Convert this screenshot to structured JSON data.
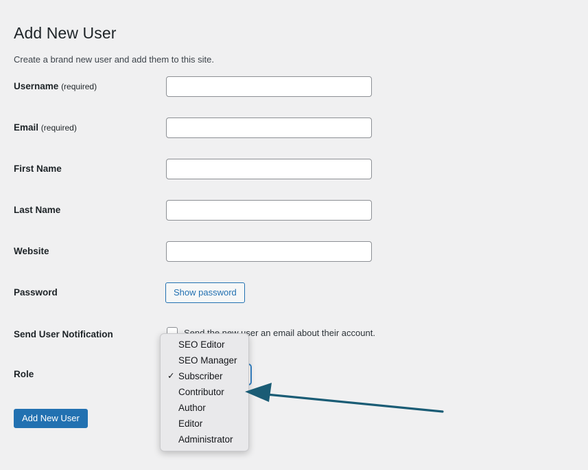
{
  "page": {
    "title": "Add New User",
    "subtitle": "Create a brand new user and add them to this site."
  },
  "form": {
    "fields": [
      {
        "label": "Username",
        "required_note": "(required)",
        "value": "",
        "placeholder": "",
        "type": "text",
        "name": "username"
      },
      {
        "label": "Email",
        "required_note": "(required)",
        "value": "",
        "placeholder": "",
        "type": "text",
        "name": "email"
      },
      {
        "label": "First Name",
        "required_note": "",
        "value": "",
        "placeholder": "",
        "type": "text",
        "name": "first-name"
      },
      {
        "label": "Last Name",
        "required_note": "",
        "value": "",
        "placeholder": "",
        "type": "text",
        "name": "last-name"
      },
      {
        "label": "Website",
        "required_note": "",
        "value": "",
        "placeholder": "",
        "type": "text",
        "name": "website"
      }
    ],
    "password": {
      "label": "Password",
      "show_password_label": "Show password"
    },
    "notification": {
      "label": "Send User Notification",
      "checkbox_label": "Send the new user an email about their account.",
      "checked": false
    },
    "role": {
      "label": "Role",
      "selected": "Subscriber",
      "options": [
        {
          "label": "SEO Editor",
          "selected": false
        },
        {
          "label": "SEO Manager",
          "selected": false
        },
        {
          "label": "Subscriber",
          "selected": true
        },
        {
          "label": "Contributor",
          "selected": false
        },
        {
          "label": "Author",
          "selected": false
        },
        {
          "label": "Editor",
          "selected": false
        },
        {
          "label": "Administrator",
          "selected": false
        }
      ],
      "checkmark_glyph": "✓"
    },
    "submit_label": "Add New User"
  },
  "annotation": {
    "arrow_color": "#1a5c75",
    "points_to": "Contributor"
  },
  "colors": {
    "page_background": "#f0f0f1",
    "accent": "#2271b1",
    "focus_ring": "#3582c4",
    "text": "#1d2327",
    "popup_background": "#e9e9eb",
    "arrow": "#1a5c75"
  }
}
